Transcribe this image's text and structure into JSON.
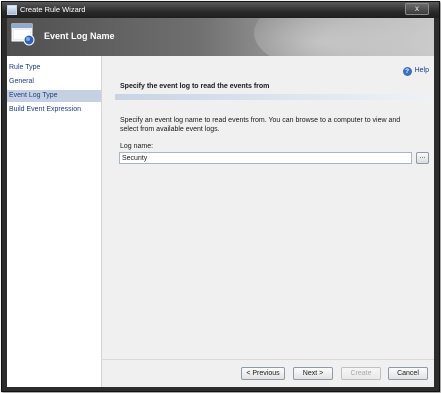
{
  "window": {
    "title": "Create Rule Wizard",
    "close_label": "x"
  },
  "banner": {
    "title": "Event Log Name"
  },
  "sidebar": {
    "items": [
      {
        "label": "Rule Type"
      },
      {
        "label": "General"
      },
      {
        "label": "Event Log Type"
      },
      {
        "label": "Build Event Expression"
      }
    ]
  },
  "help": {
    "icon_glyph": "?",
    "label": "Help"
  },
  "main": {
    "section_title": "Specify the event log to read the events from",
    "description": "Specify an event log name to read events from. You can browse to a computer to view and select from available event logs.",
    "log_name_label": "Log name:",
    "log_name_value": "Security",
    "browse_label": "..."
  },
  "buttons": {
    "previous": "< Previous",
    "next": "Next >",
    "create": "Create",
    "cancel": "Cancel"
  },
  "colors": {
    "link": "#1c3f8a",
    "selected_nav": "#c5d1e0",
    "client_bg": "#f0f0f0"
  }
}
